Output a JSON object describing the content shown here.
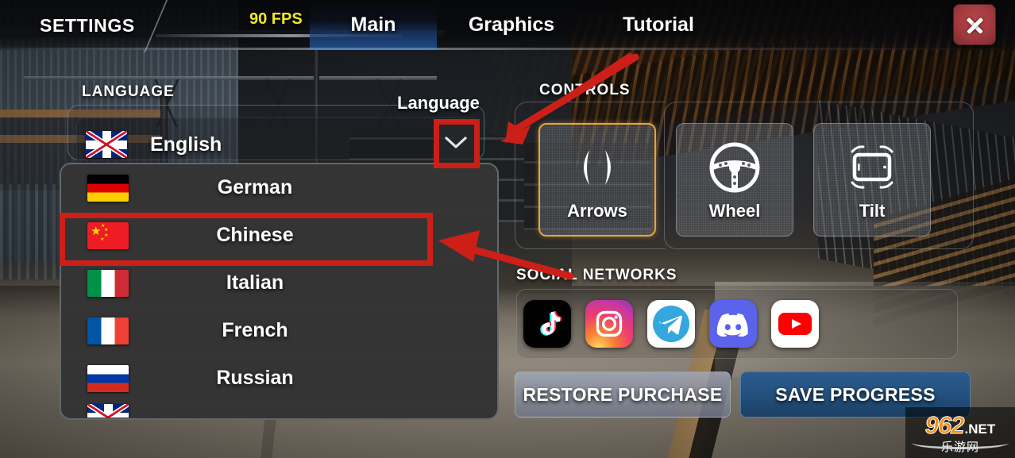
{
  "header": {
    "title": "SETTINGS",
    "fps": "90 FPS",
    "tabs": [
      {
        "label": "Main",
        "active": true
      },
      {
        "label": "Graphics",
        "active": false
      },
      {
        "label": "Tutorial",
        "active": false
      }
    ],
    "close_icon": "close-icon"
  },
  "language_section": {
    "label": "LANGUAGE",
    "field_label": "Language",
    "selected": {
      "name": "English",
      "flag": "uk-flag"
    },
    "chevron_icon": "chevron-down-icon",
    "options": [
      {
        "name": "German",
        "flag": "germany-flag"
      },
      {
        "name": "Chinese",
        "flag": "china-flag",
        "highlighted": true
      },
      {
        "name": "Italian",
        "flag": "italy-flag"
      },
      {
        "name": "French",
        "flag": "france-flag"
      },
      {
        "name": "Russian",
        "flag": "russia-flag"
      }
    ]
  },
  "controls_section": {
    "label": "CONTROLS",
    "options": [
      {
        "label": "Arrows",
        "icon": "arrows-icon",
        "selected": true
      },
      {
        "label": "Wheel",
        "icon": "steering-wheel-icon",
        "selected": false
      },
      {
        "label": "Tilt",
        "icon": "tilt-phone-icon",
        "selected": false
      }
    ]
  },
  "social_section": {
    "label": "SOCIAL NETWORKS",
    "icons": [
      {
        "name": "tiktok-icon"
      },
      {
        "name": "instagram-icon"
      },
      {
        "name": "telegram-icon"
      },
      {
        "name": "discord-icon"
      },
      {
        "name": "youtube-icon"
      }
    ]
  },
  "bottom_buttons": {
    "restore": "RESTORE PURCHASE",
    "save": "SAVE PROGRESS"
  },
  "annotations": {
    "highlight_color": "#cc1f18",
    "boxes": [
      {
        "target": "chevron-down-icon"
      },
      {
        "target": "chinese-option"
      }
    ],
    "arrows": [
      {
        "points_to": "chevron-down-icon"
      },
      {
        "points_to": "chinese-option"
      }
    ]
  },
  "watermark": {
    "number": "962",
    "tld": ".NET",
    "chinese": "乐游网"
  },
  "colors": {
    "accent_selected": "#e3a53a",
    "fps_yellow": "#f2ea20",
    "tab_active_blue": "#1a427c",
    "close_red": "#a03a3e",
    "annotation_red": "#cc1f18",
    "dropdown_bg": "#343434",
    "save_blue": "#24527f"
  }
}
